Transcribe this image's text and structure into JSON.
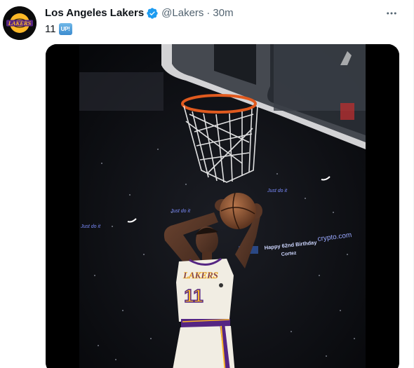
{
  "tweet": {
    "display_name": "Los Angeles Lakers",
    "handle": "@Lakers",
    "separator": "·",
    "time": "30m",
    "text": "11",
    "emoji_label": "UP!"
  },
  "avatar": {
    "logo_text": "LAKERS"
  },
  "media": {
    "jersey_team": "LAKERS",
    "jersey_number": "11",
    "banner_text": "Happy 62nd Birthday",
    "banner_text_2": "Cortez",
    "sponsor_text": "crypto.com",
    "ribbon_text": "Just do it"
  },
  "colors": {
    "verified": "#1d9bf0",
    "lakers_purple": "#552583",
    "lakers_gold": "#fdb927",
    "text_primary": "#0f1419",
    "text_secondary": "#536471"
  },
  "icons": {
    "verified": "verified-badge-icon",
    "more": "more-options-icon"
  }
}
